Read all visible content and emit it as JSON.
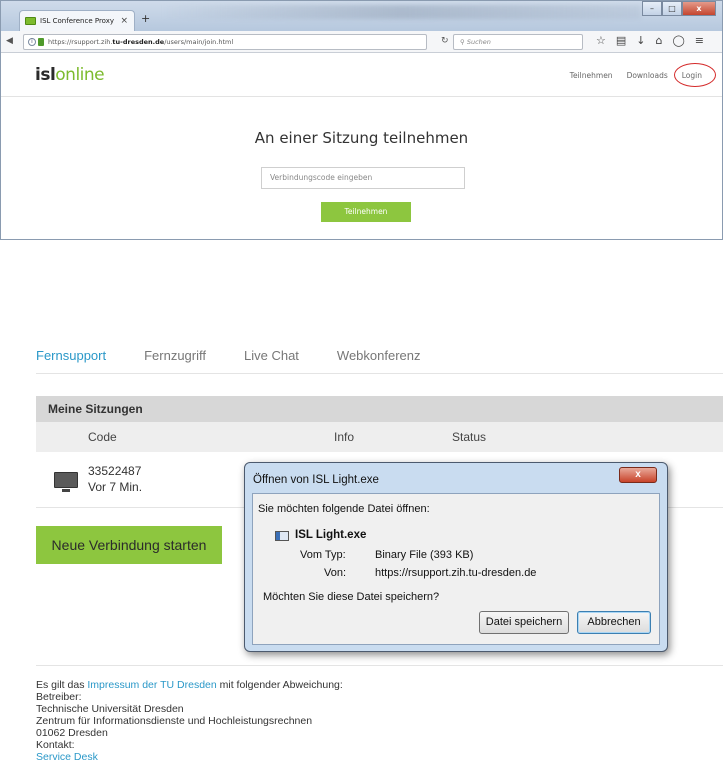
{
  "browser": {
    "tab_title": "ISL Conference Proxy",
    "tab_close": "×",
    "new_tab": "+",
    "url_prefix": "https://rsupport.zih.",
    "url_domain": "tu-dresden.de",
    "url_path": "/users/main/join.html",
    "search_placeholder": "Suchen",
    "window_min": "–",
    "window_max": "□",
    "window_close": "x"
  },
  "isl": {
    "logo_isl": "isl",
    "logo_online": "online",
    "nav": {
      "join": "Teilnehmen",
      "downloads": "Downloads",
      "login": "Login"
    },
    "join_title": "An einer Sitzung teilnehmen",
    "join_placeholder": "Verbindungscode eingeben",
    "join_button": "Teilnehmen"
  },
  "portal": {
    "tabs": [
      {
        "label": "Fernsupport"
      },
      {
        "label": "Fernzugriff"
      },
      {
        "label": "Live Chat"
      },
      {
        "label": "Webkonferenz"
      }
    ],
    "sessions_title": "Meine Sitzungen",
    "columns": {
      "code": "Code",
      "info": "Info",
      "status": "Status"
    },
    "session": {
      "code": "33522487",
      "time": "Vor 7 Min."
    },
    "new_connection": "Neue Verbindung starten"
  },
  "footer": {
    "line1_pre": "Es gilt das ",
    "line1_link": "Impressum der TU Dresden",
    "line1_post": " mit folgender Abweichung:",
    "operator_label": "Betreiber:",
    "org1": "Technische Universität Dresden",
    "org2": "Zentrum für Informationsdienste und Hochleistungsrechnen",
    "address": "01062 Dresden",
    "contact_label": "Kontakt:",
    "contact_link": "Service Desk"
  },
  "dialog": {
    "title": "Öffnen von ISL Light.exe",
    "close": "x",
    "question": "Sie möchten folgende Datei öffnen:",
    "filename": "ISL Light.exe",
    "type_label": "Vom Typ:",
    "type_value": "Binary File (393 KB)",
    "from_label": "Von:",
    "from_value": "https://rsupport.zih.tu-dresden.de",
    "save_question": "Möchten Sie diese Datei speichern?",
    "save_button": "Datei speichern",
    "cancel_button": "Abbrechen"
  },
  "colors": {
    "accent_green": "#8dc63f",
    "link_blue": "#2a98c8",
    "login_highlight": "#d42a2a"
  }
}
